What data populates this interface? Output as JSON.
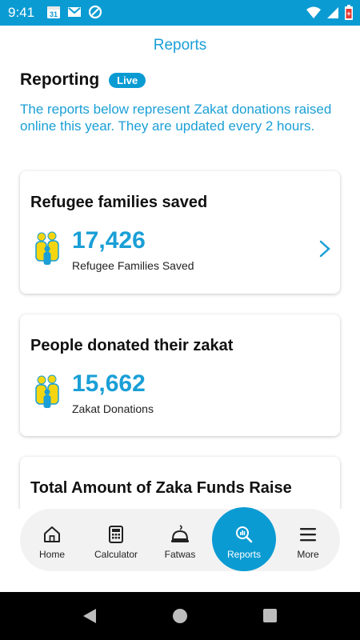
{
  "status_bar": {
    "time": "9:41",
    "left_icons": [
      "calendar-icon",
      "gmail-icon",
      "data-saver-icon"
    ],
    "calendar_day": "31",
    "right_icons": [
      "wifi-icon",
      "signal-icon",
      "battery-icon"
    ]
  },
  "header": {
    "title": "Reports"
  },
  "section": {
    "title": "Reporting",
    "badge": "Live",
    "description": "The reports below represent Zakat donations raised online this year. They are updated every 2 hours."
  },
  "cards": [
    {
      "title": "Refugee families saved",
      "value": "17,426",
      "label": "Refugee Families Saved",
      "icon": "family-icon",
      "has_chevron": true
    },
    {
      "title": "People donated their zakat",
      "value": "15,662",
      "label": "Zakat Donations",
      "icon": "family-icon",
      "has_chevron": false
    },
    {
      "title": "Total Amount of Zaka Funds Raise"
    }
  ],
  "bottom_nav": {
    "items": [
      {
        "label": "Home",
        "icon": "home-icon"
      },
      {
        "label": "Calculator",
        "icon": "calculator-icon"
      },
      {
        "label": "Fatwas",
        "icon": "fatwa-icon"
      },
      {
        "label": "Reports",
        "icon": "reports-search-icon",
        "active": true
      },
      {
        "label": "More",
        "icon": "menu-icon"
      }
    ]
  },
  "colors": {
    "accent": "#0b9bd3",
    "accent_text": "#1a9fd6",
    "icon_yellow": "#f5d50f",
    "icon_blue": "#1a9fd6",
    "nav_background": "#f2f2f2"
  }
}
